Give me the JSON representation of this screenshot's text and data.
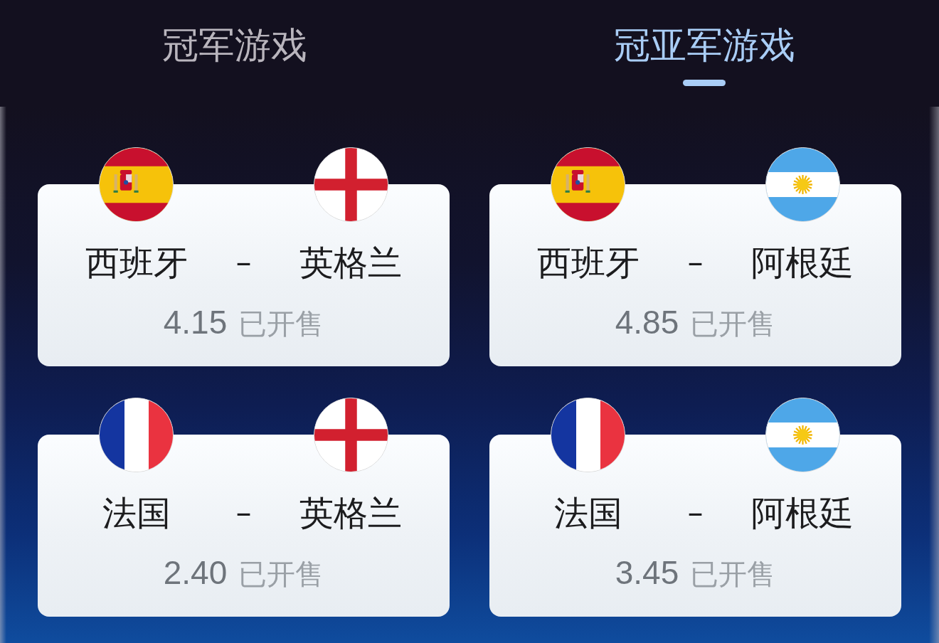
{
  "tabs": [
    {
      "label": "冠军游戏",
      "selected": false
    },
    {
      "label": "冠亚军游戏",
      "selected": true
    }
  ],
  "matches": [
    {
      "home": {
        "name": "西班牙",
        "kind": "spain"
      },
      "separator": "–",
      "away": {
        "name": "英格兰",
        "kind": "england"
      },
      "odds": "4.15",
      "status": "已开售"
    },
    {
      "home": {
        "name": "西班牙",
        "kind": "spain"
      },
      "separator": "–",
      "away": {
        "name": "阿根廷",
        "kind": "argentina"
      },
      "odds": "4.85",
      "status": "已开售"
    },
    {
      "home": {
        "name": "法国",
        "kind": "france"
      },
      "separator": "–",
      "away": {
        "name": "英格兰",
        "kind": "england"
      },
      "odds": "2.40",
      "status": "已开售"
    },
    {
      "home": {
        "name": "法国",
        "kind": "france"
      },
      "separator": "–",
      "away": {
        "name": "阿根廷",
        "kind": "argentina"
      },
      "odds": "3.45",
      "status": "已开售"
    }
  ]
}
